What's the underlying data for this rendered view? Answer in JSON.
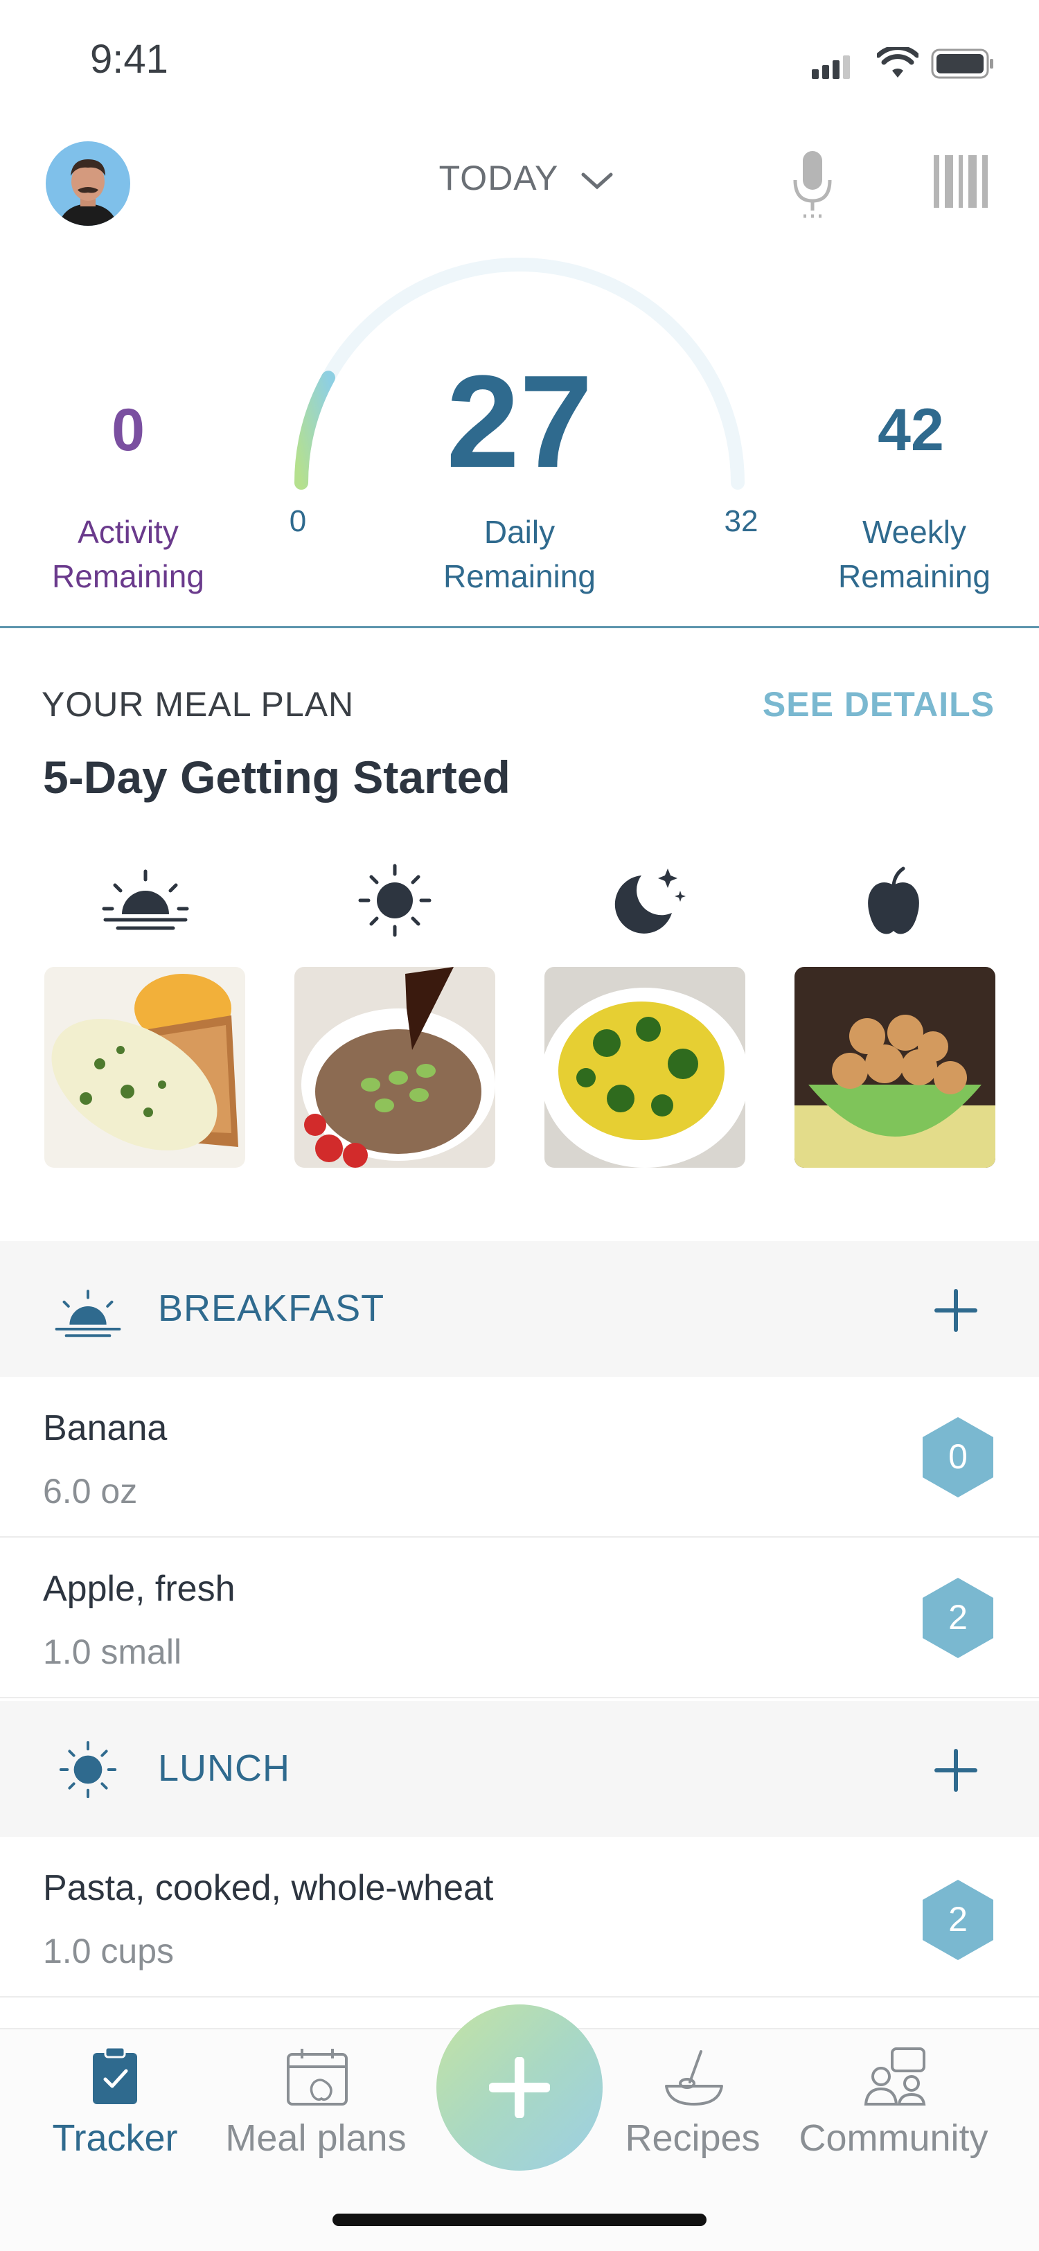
{
  "status": {
    "time": "9:41"
  },
  "header": {
    "date_selector": "TODAY"
  },
  "summary": {
    "activity": {
      "value": "0",
      "label_line1": "Activity",
      "label_line2": "Remaining"
    },
    "daily": {
      "value": "27",
      "label_line1": "Daily",
      "label_line2": "Remaining",
      "gauge_min": "0",
      "gauge_max": "32",
      "gauge_fraction": 0.16
    },
    "weekly": {
      "value": "42",
      "label_line1": "Weekly",
      "label_line2": "Remaining"
    }
  },
  "meal_plan": {
    "label": "YOUR MEAL PLAN",
    "see_details": "SEE DETAILS",
    "title": "5-Day Getting Started",
    "times": [
      "sunrise-icon",
      "sun-icon",
      "moon-icon",
      "apple-icon"
    ]
  },
  "sections": [
    {
      "title": "BREAKFAST",
      "icon": "sunrise-icon",
      "items": [
        {
          "name": "Banana",
          "qty": "6.0 oz",
          "points": "0"
        },
        {
          "name": "Apple, fresh",
          "qty": "1.0 small",
          "points": "2"
        }
      ]
    },
    {
      "title": "LUNCH",
      "icon": "sun-icon",
      "items": [
        {
          "name": "Pasta, cooked, whole-wheat",
          "qty": "1.0 cups",
          "points": "2"
        }
      ]
    }
  ],
  "tabs": [
    {
      "label": "Tracker",
      "icon": "clipboard-check-icon",
      "active": true
    },
    {
      "label": "Meal plans",
      "icon": "calendar-apple-icon",
      "active": false
    },
    {
      "label": "Recipes",
      "icon": "bowl-whisk-icon",
      "active": false
    },
    {
      "label": "Community",
      "icon": "community-icon",
      "active": false
    }
  ],
  "colors": {
    "accent": "#2f6a8e",
    "purple": "#7a4fa0",
    "hex_badge": "#7ab8d0",
    "link": "#7ab8d0"
  }
}
